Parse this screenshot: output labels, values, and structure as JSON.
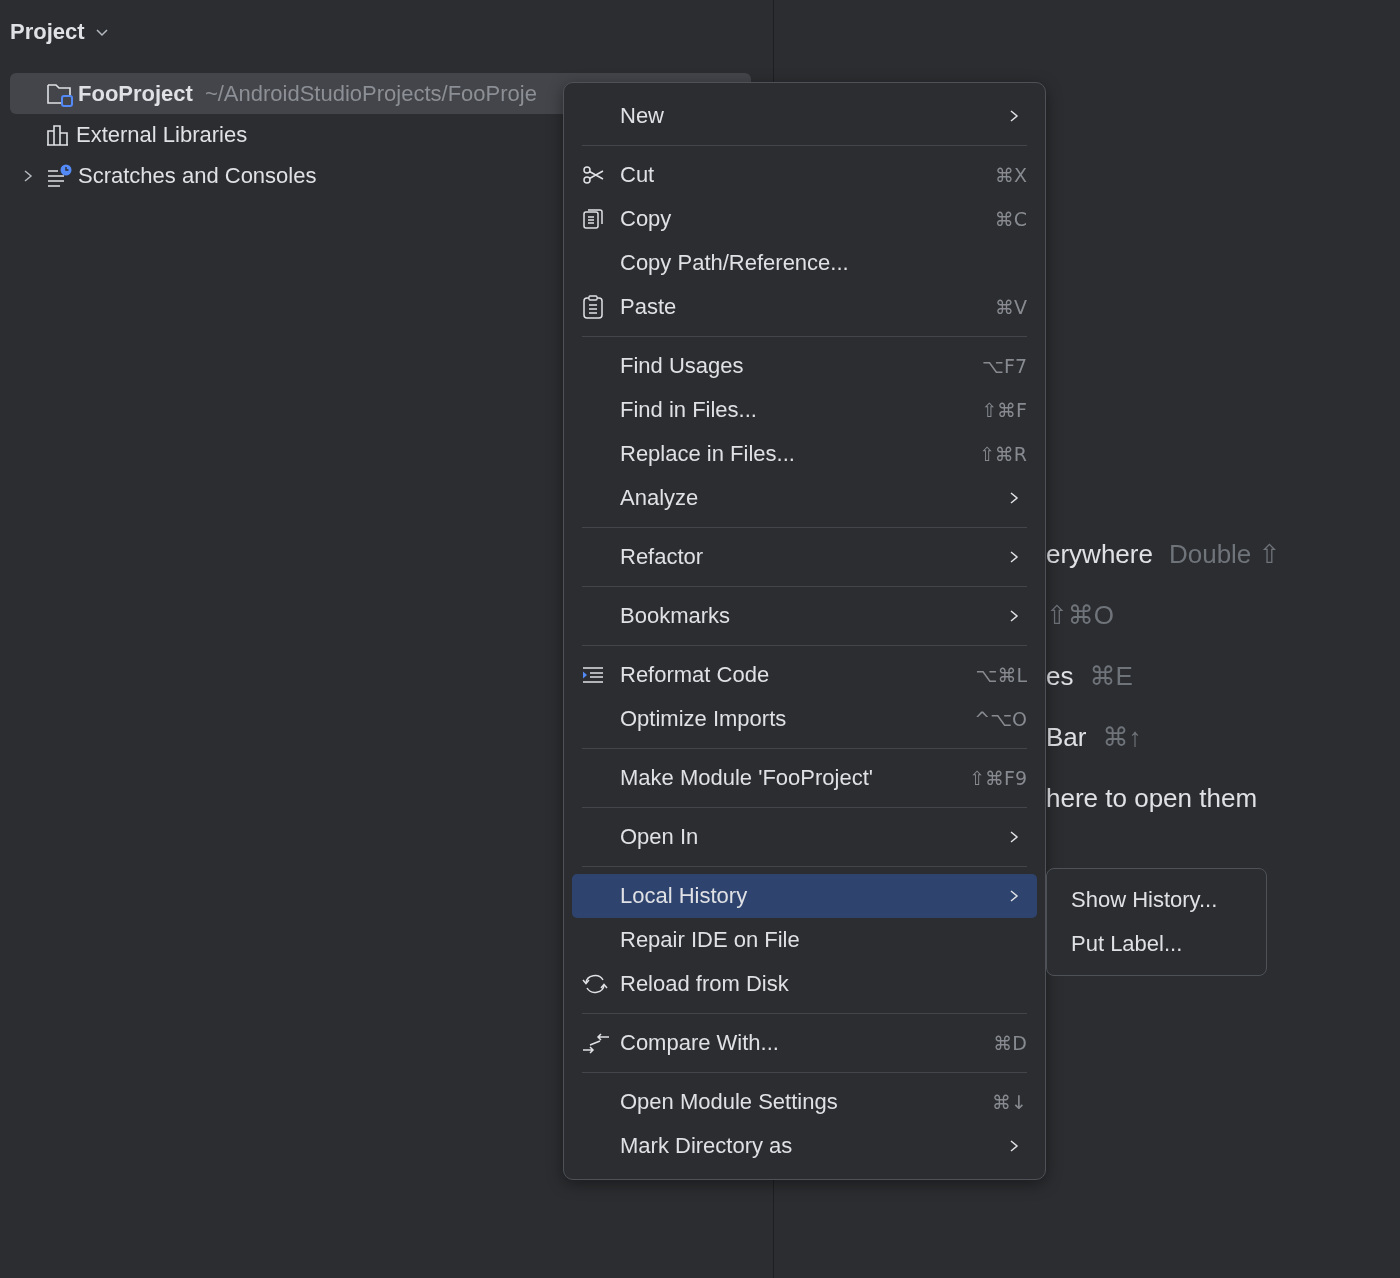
{
  "project_panel": {
    "title": "Project",
    "tree": [
      {
        "label": "FooProject",
        "path": "~/AndroidStudioProjects/FooProje",
        "selected": true,
        "expandable": false
      },
      {
        "label": "External Libraries",
        "selected": false,
        "expandable": false
      },
      {
        "label": "Scratches and Consoles",
        "selected": false,
        "expandable": true
      }
    ]
  },
  "editor_hints": [
    {
      "text": "erywhere",
      "shortcut": "Double ⇧"
    },
    {
      "shortcut": "⇧⌘O"
    },
    {
      "text": "es",
      "shortcut": "⌘E"
    },
    {
      "text": "Bar",
      "shortcut": "⌘↑"
    },
    {
      "text": "here to open them"
    }
  ],
  "context_menu": {
    "items": [
      {
        "kind": "item",
        "label": "New",
        "submenu": true,
        "selected": false
      },
      {
        "kind": "separator"
      },
      {
        "kind": "item",
        "label": "Cut",
        "shortcut": "⌘X",
        "submenu": false,
        "selected": false
      },
      {
        "kind": "item",
        "label": "Copy",
        "shortcut": "⌘C",
        "submenu": false,
        "selected": false
      },
      {
        "kind": "item",
        "label": "Copy Path/Reference...",
        "submenu": false,
        "selected": false
      },
      {
        "kind": "item",
        "label": "Paste",
        "shortcut": "⌘V",
        "submenu": false,
        "selected": false
      },
      {
        "kind": "separator"
      },
      {
        "kind": "item",
        "label": "Find Usages",
        "shortcut": "⌥F7",
        "submenu": false,
        "selected": false
      },
      {
        "kind": "item",
        "label": "Find in Files...",
        "shortcut": "⇧⌘F",
        "submenu": false,
        "selected": false
      },
      {
        "kind": "item",
        "label": "Replace in Files...",
        "shortcut": "⇧⌘R",
        "submenu": false,
        "selected": false
      },
      {
        "kind": "item",
        "label": "Analyze",
        "submenu": true,
        "selected": false
      },
      {
        "kind": "separator"
      },
      {
        "kind": "item",
        "label": "Refactor",
        "submenu": true,
        "selected": false
      },
      {
        "kind": "separator"
      },
      {
        "kind": "item",
        "label": "Bookmarks",
        "submenu": true,
        "selected": false
      },
      {
        "kind": "separator"
      },
      {
        "kind": "item",
        "label": "Reformat Code",
        "shortcut": "⌥⌘L",
        "submenu": false,
        "selected": false
      },
      {
        "kind": "item",
        "label": "Optimize Imports",
        "shortcut": "^⌥O",
        "submenu": false,
        "selected": false
      },
      {
        "kind": "separator"
      },
      {
        "kind": "item",
        "label": "Make Module 'FooProject'",
        "shortcut": "⇧⌘F9",
        "submenu": false,
        "selected": false
      },
      {
        "kind": "separator"
      },
      {
        "kind": "item",
        "label": "Open In",
        "submenu": true,
        "selected": false
      },
      {
        "kind": "separator"
      },
      {
        "kind": "item",
        "label": "Local History",
        "submenu": true,
        "selected": true
      },
      {
        "kind": "item",
        "label": "Repair IDE on File",
        "submenu": false,
        "selected": false
      },
      {
        "kind": "item",
        "label": "Reload from Disk",
        "submenu": false,
        "selected": false
      },
      {
        "kind": "separator"
      },
      {
        "kind": "item",
        "label": "Compare With...",
        "shortcut": "⌘D",
        "submenu": false,
        "selected": false
      },
      {
        "kind": "separator"
      },
      {
        "kind": "item",
        "label": "Open Module Settings",
        "shortcut": "⌘↓",
        "submenu": false,
        "selected": false
      },
      {
        "kind": "item",
        "label": "Mark Directory as",
        "submenu": true,
        "selected": false
      }
    ]
  },
  "submenu": {
    "items": [
      {
        "label": "Show History...",
        "selected": false
      },
      {
        "label": "Put Label...",
        "selected": false
      }
    ]
  }
}
